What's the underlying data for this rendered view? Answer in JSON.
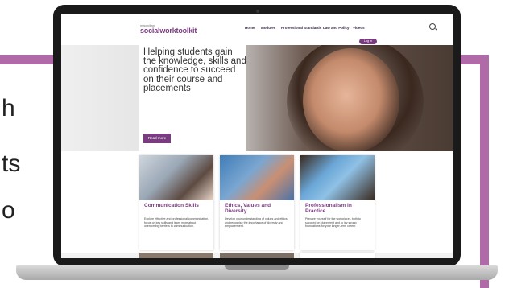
{
  "background": {
    "text_lines": [
      "h",
      "ts",
      "o"
    ],
    "accent_color": "#b06aa8"
  },
  "site": {
    "logo_top": "macmillan",
    "logo_main": "socialworktoolkit",
    "nav": [
      "Home",
      "Modules",
      "Professional Standards",
      "Law and Policy",
      "Videos"
    ],
    "login_label": "Log in",
    "hero_title": "Helping students gain the knowledge, skills and confidence to succeed on their course and placements",
    "read_more": "Read more",
    "cards": [
      {
        "title": "Communication Skills",
        "text": "Explore effective and professional communication, focus on key skills and learn more about overcoming barriers to communication."
      },
      {
        "title": "Ethics, Values and Diversity",
        "text": "Develop your understanding of values and ethics and recognise the importance of diversity and empowerment."
      },
      {
        "title": "Professionalism in Practice",
        "text": "Prepare yourself for the workplace - both to succeed on placement and to lay strong foundations for your longer-term career."
      }
    ],
    "brand_color": "#7a3c80"
  }
}
